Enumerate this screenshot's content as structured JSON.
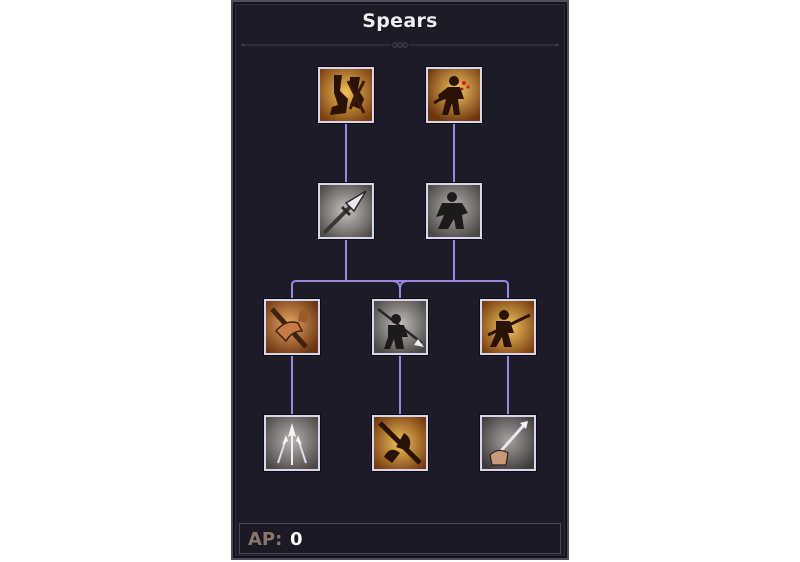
{
  "panel": {
    "title": "Spears"
  },
  "ap": {
    "label": "AP:",
    "value": "0"
  },
  "skills": [
    {
      "tier": 1,
      "icon": "boots-strike-icon",
      "theme": "gold"
    },
    {
      "tier": 1,
      "icon": "bleeding-warrior-icon",
      "theme": "gold"
    },
    {
      "tier": 2,
      "icon": "spear-tip-icon",
      "theme": "stone"
    },
    {
      "tier": 2,
      "icon": "crouching-figure-icon",
      "theme": "stone"
    },
    {
      "tier": 3,
      "icon": "arm-strike-icon",
      "theme": "gold"
    },
    {
      "tier": 3,
      "icon": "spear-throw-icon",
      "theme": "stone"
    },
    {
      "tier": 3,
      "icon": "spear-charge-icon",
      "theme": "gold"
    },
    {
      "tier": 4,
      "icon": "spear-volley-icon",
      "theme": "stone"
    },
    {
      "tier": 4,
      "icon": "crossed-spears-icon",
      "theme": "gold"
    },
    {
      "tier": 4,
      "icon": "hand-grip-spear-icon",
      "theme": "stone"
    }
  ],
  "colors": {
    "panel_bg": "#1c1b28",
    "connector": "#9a86e0",
    "gold_icon_bg": "#c98a2a",
    "stone_icon_bg": "#9a9492",
    "ap_label": "#8b7766"
  }
}
